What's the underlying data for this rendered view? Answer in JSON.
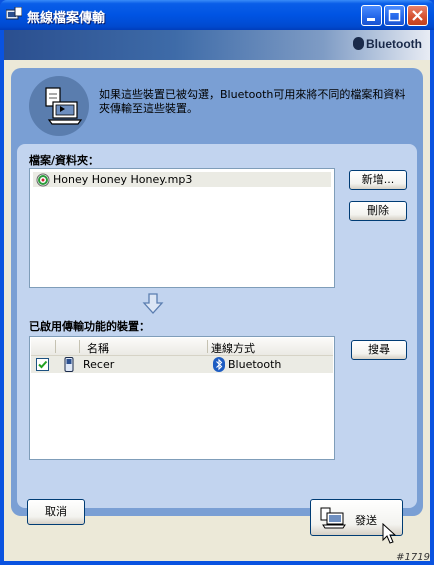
{
  "window": {
    "title": "無線檔案傳輸",
    "brand": "Bluetooth"
  },
  "header": {
    "description": "如果這些裝置已被勾選，Bluetooth可用來將不同的檔案和資料夾傳輸至這些裝置。"
  },
  "files": {
    "label": "檔案/資料夾：",
    "items": [
      {
        "name": "Honey Honey Honey.mp3",
        "icon": "audio-file-icon"
      }
    ],
    "add_button": "新增...",
    "delete_button": "刪除"
  },
  "devices": {
    "label": "已啟用傳輸功能的裝置：",
    "columns": {
      "name": "名稱",
      "connection": "連線方式"
    },
    "rows": [
      {
        "checked": true,
        "name": "Recer",
        "connection": "Bluetooth",
        "icon": "phone-icon"
      }
    ],
    "search_button": "搜尋"
  },
  "footer": {
    "cancel_button": "取消",
    "send_button": "發送"
  },
  "watermark": "#1719",
  "colors": {
    "titlebar": "#0054e3",
    "panel_outer": "#7a9fd4",
    "panel_inner": "#c2d4ef",
    "check": "#21a121"
  }
}
